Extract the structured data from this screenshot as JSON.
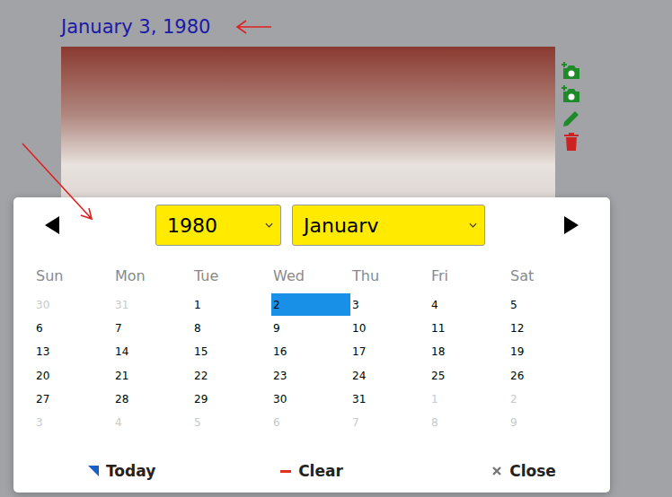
{
  "page": {
    "date_title": "January 3, 1980"
  },
  "calendar": {
    "year_select": {
      "value": "1980",
      "highlighted": true
    },
    "month_select": {
      "value": "Januarv",
      "highlighted": true
    },
    "weekdays": [
      "Sun",
      "Mon",
      "Tue",
      "Wed",
      "Thu",
      "Fri",
      "Sat"
    ],
    "weeks": [
      [
        {
          "day": "30",
          "outside": true,
          "selected": false
        },
        {
          "day": "31",
          "outside": true,
          "selected": false
        },
        {
          "day": "1",
          "outside": false,
          "selected": false
        },
        {
          "day": "2",
          "outside": false,
          "selected": true
        },
        {
          "day": "3",
          "outside": false,
          "selected": false
        },
        {
          "day": "4",
          "outside": false,
          "selected": false
        },
        {
          "day": "5",
          "outside": false,
          "selected": false
        }
      ],
      [
        {
          "day": "6",
          "outside": false,
          "selected": false
        },
        {
          "day": "7",
          "outside": false,
          "selected": false
        },
        {
          "day": "8",
          "outside": false,
          "selected": false
        },
        {
          "day": "9",
          "outside": false,
          "selected": false
        },
        {
          "day": "10",
          "outside": false,
          "selected": false
        },
        {
          "day": "11",
          "outside": false,
          "selected": false
        },
        {
          "day": "12",
          "outside": false,
          "selected": false
        }
      ],
      [
        {
          "day": "13",
          "outside": false,
          "selected": false
        },
        {
          "day": "14",
          "outside": false,
          "selected": false
        },
        {
          "day": "15",
          "outside": false,
          "selected": false
        },
        {
          "day": "16",
          "outside": false,
          "selected": false
        },
        {
          "day": "17",
          "outside": false,
          "selected": false
        },
        {
          "day": "18",
          "outside": false,
          "selected": false
        },
        {
          "day": "19",
          "outside": false,
          "selected": false
        }
      ],
      [
        {
          "day": "20",
          "outside": false,
          "selected": false
        },
        {
          "day": "21",
          "outside": false,
          "selected": false
        },
        {
          "day": "22",
          "outside": false,
          "selected": false
        },
        {
          "day": "23",
          "outside": false,
          "selected": false
        },
        {
          "day": "24",
          "outside": false,
          "selected": false
        },
        {
          "day": "25",
          "outside": false,
          "selected": false
        },
        {
          "day": "26",
          "outside": false,
          "selected": false
        }
      ],
      [
        {
          "day": "27",
          "outside": false,
          "selected": false
        },
        {
          "day": "28",
          "outside": false,
          "selected": false
        },
        {
          "day": "29",
          "outside": false,
          "selected": false
        },
        {
          "day": "30",
          "outside": false,
          "selected": false
        },
        {
          "day": "31",
          "outside": false,
          "selected": false
        },
        {
          "day": "1",
          "outside": true,
          "selected": false
        },
        {
          "day": "2",
          "outside": true,
          "selected": false
        }
      ],
      [
        {
          "day": "3",
          "outside": true,
          "selected": false
        },
        {
          "day": "4",
          "outside": true,
          "selected": false
        },
        {
          "day": "5",
          "outside": true,
          "selected": false
        },
        {
          "day": "6",
          "outside": true,
          "selected": false
        },
        {
          "day": "7",
          "outside": true,
          "selected": false
        },
        {
          "day": "8",
          "outside": true,
          "selected": false
        },
        {
          "day": "9",
          "outside": true,
          "selected": false
        }
      ]
    ],
    "footer": [
      {
        "label": "Today",
        "kind": "today",
        "color": "#1a5fc8"
      },
      {
        "label": "Clear",
        "kind": "clear",
        "color": "#e0301e"
      },
      {
        "label": "Close",
        "kind": "close",
        "color": "#777777"
      }
    ]
  }
}
